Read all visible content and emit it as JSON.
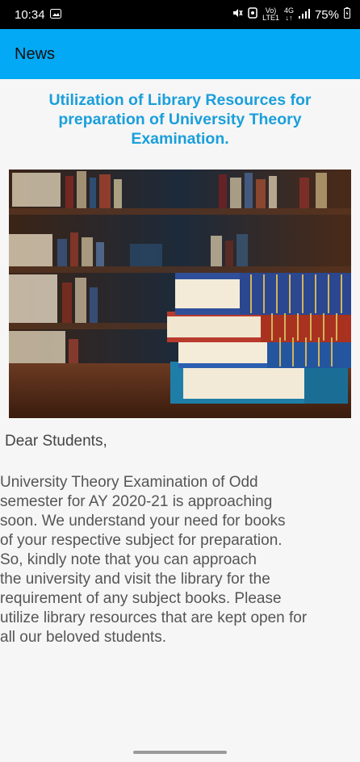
{
  "status_bar": {
    "time": "10:34",
    "network_top": "Vo)",
    "network_bottom": "LTE1",
    "data_top": "4G",
    "data_bottom": "↓↑",
    "battery": "75%"
  },
  "app_bar": {
    "title": "News"
  },
  "article": {
    "title": "Utilization of Library Resources for preparation of University Theory Examination.",
    "greeting": "Dear Students,",
    "body_lines": [
      "University Theory Examination of Odd",
      "semester for AY 2020-21 is approaching",
      "soon. We understand your need for books",
      "of your respective subject for preparation.",
      "So, kindly note that you can approach",
      "the university and visit the library for the",
      "requirement of any subject books. Please",
      "utilize library resources that are kept open for",
      "all our beloved students."
    ]
  }
}
